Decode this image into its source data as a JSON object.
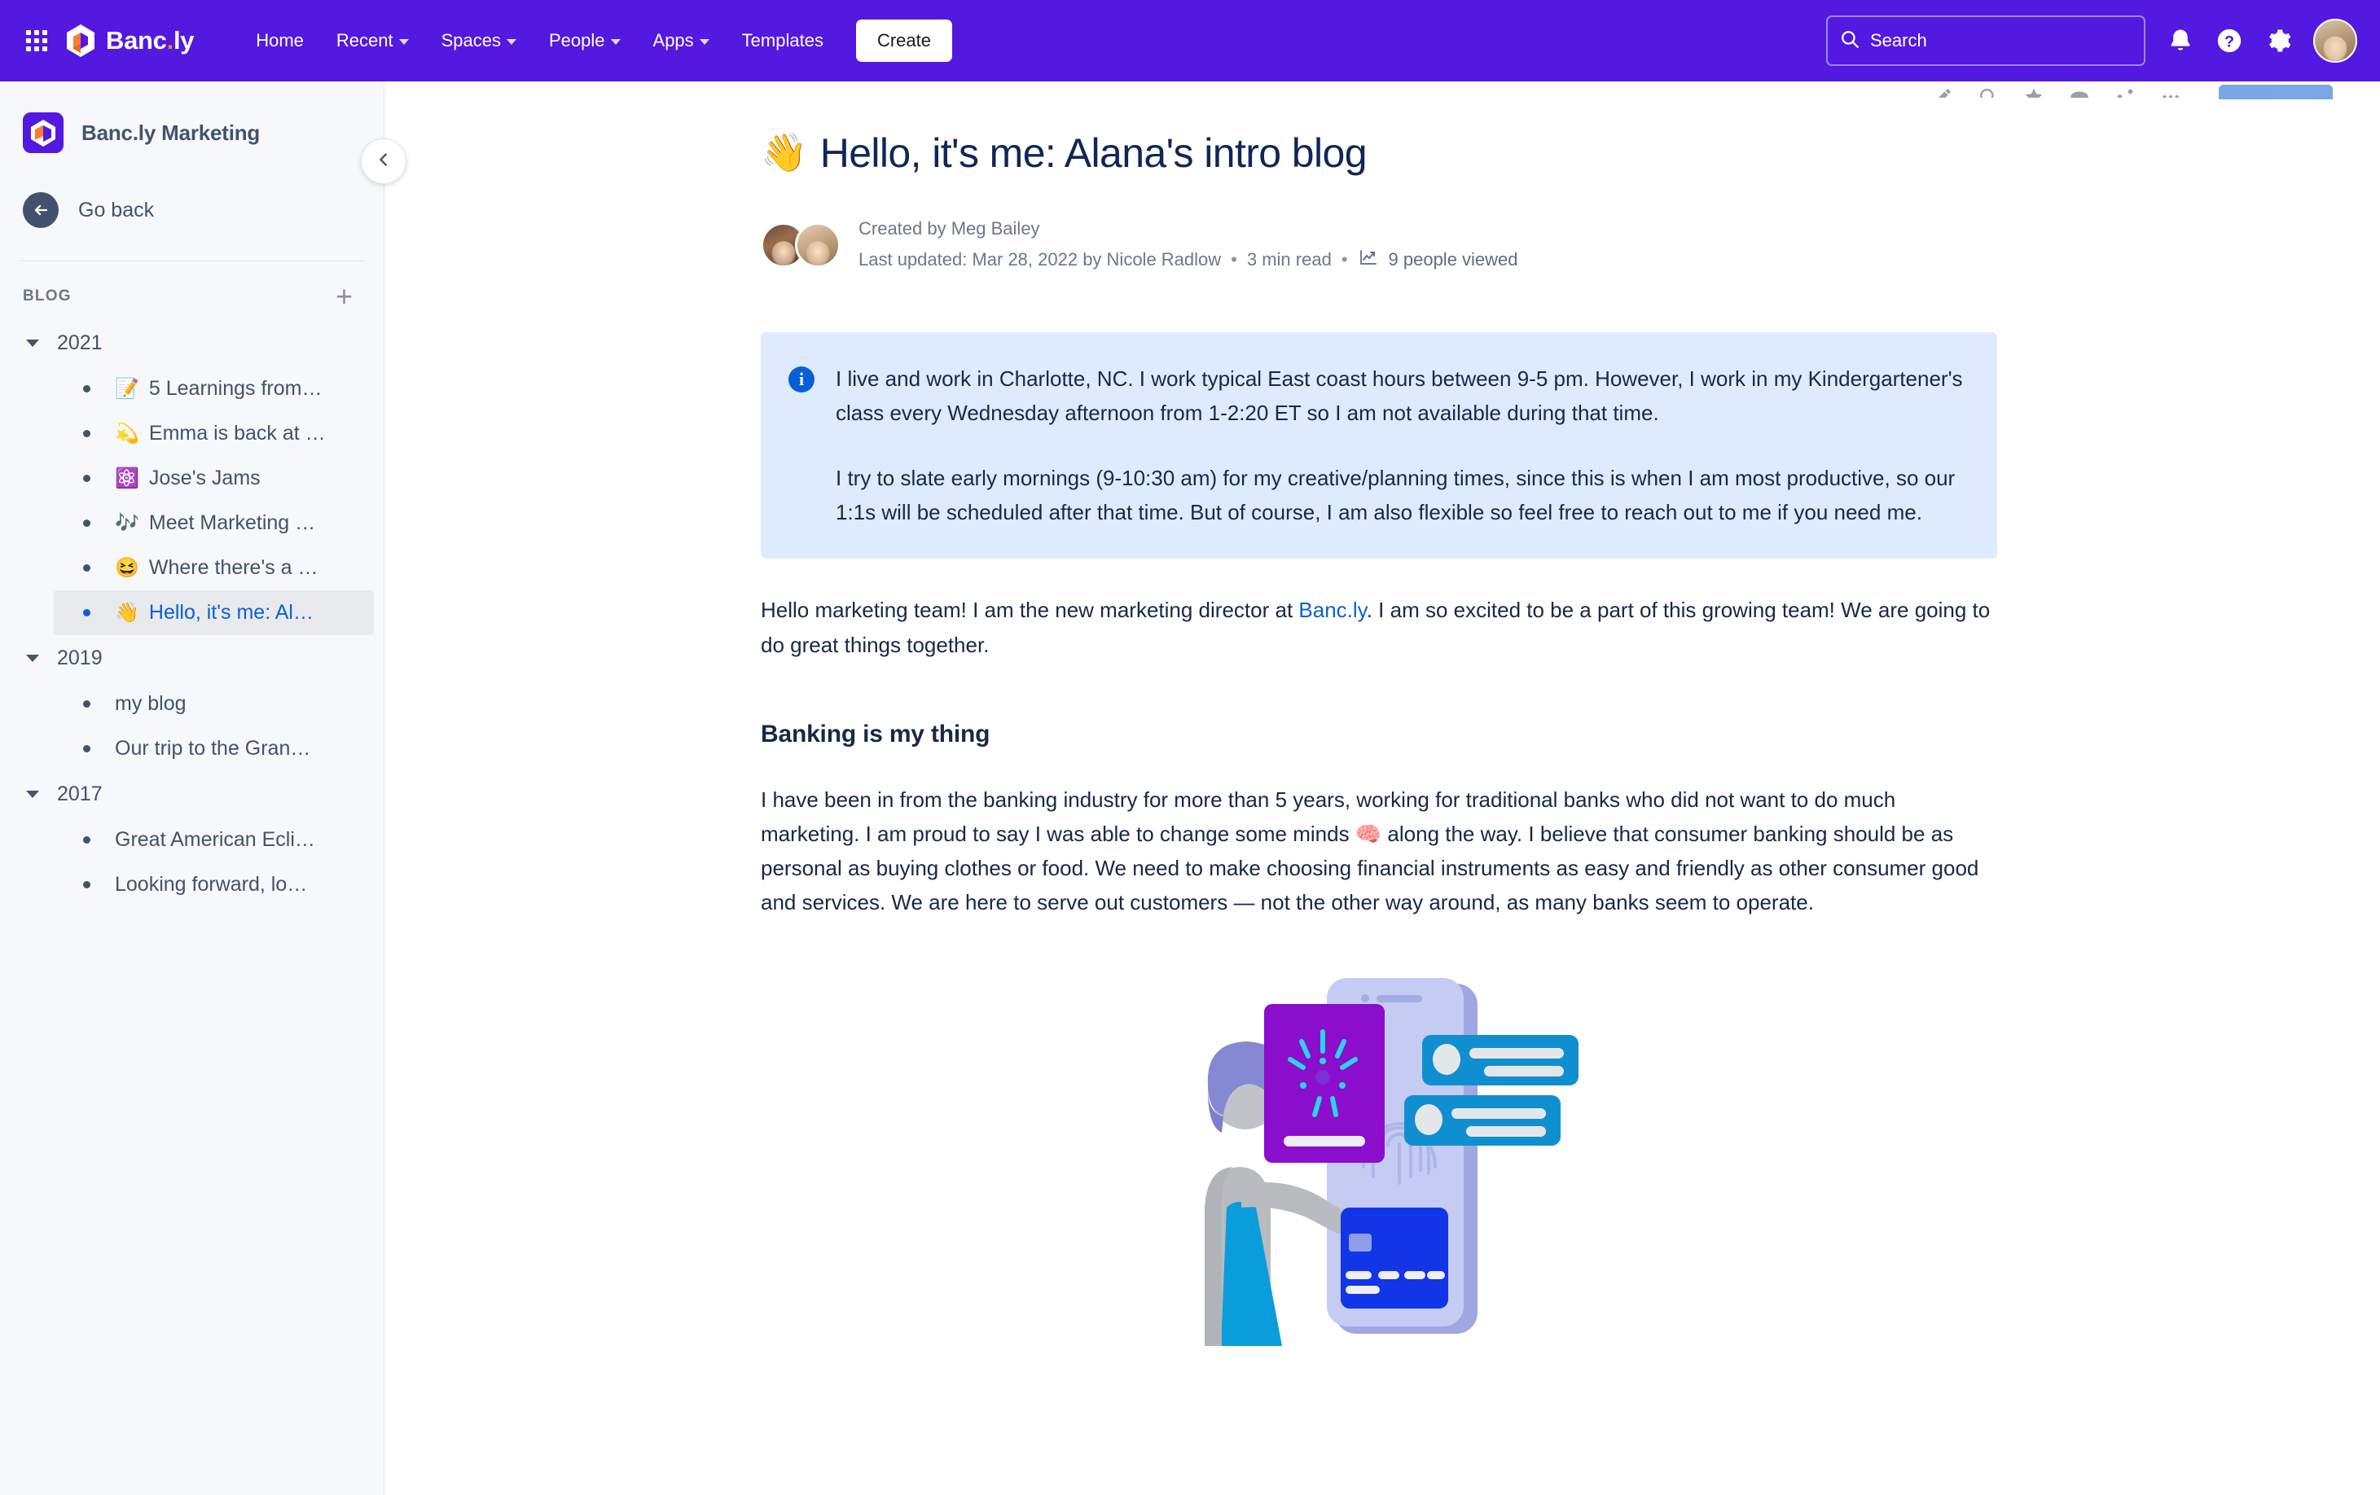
{
  "topnav": {
    "app_switcher_icon": "grid-apps-icon",
    "brand": {
      "name_main": "Banc",
      "name_dot": ".",
      "name_tld": "ly",
      "logo_icon": "bancly-hexagon-logo"
    },
    "links": [
      {
        "label": "Home",
        "has_caret": false
      },
      {
        "label": "Recent",
        "has_caret": true
      },
      {
        "label": "Spaces",
        "has_caret": true
      },
      {
        "label": "People",
        "has_caret": true
      },
      {
        "label": "Apps",
        "has_caret": true
      },
      {
        "label": "Templates",
        "has_caret": false
      }
    ],
    "create_label": "Create",
    "search": {
      "placeholder": "Search",
      "icon": "search-icon"
    },
    "icons": [
      {
        "name": "notification-bell-icon"
      },
      {
        "name": "help-question-icon"
      },
      {
        "name": "settings-gear-icon"
      }
    ],
    "avatar": "user-avatar",
    "bg_color": "#5319E0"
  },
  "sidebar": {
    "space_title": "Banc.ly Marketing",
    "go_back_label": "Go back",
    "section_label": "BLOG",
    "add_label": "+",
    "collapse_icon": "chevron-left-icon",
    "tree": [
      {
        "year": "2021",
        "expanded": true,
        "items": [
          {
            "emoji": "📝",
            "label": "5 Learnings from…",
            "selected": false
          },
          {
            "emoji": "💫",
            "label": "Emma is back at …",
            "selected": false
          },
          {
            "emoji": "⚛️",
            "label": "Jose's Jams",
            "selected": false
          },
          {
            "emoji": "🎶",
            "label": "Meet Marketing …",
            "selected": false
          },
          {
            "emoji": "😆",
            "label": "Where there's a …",
            "selected": false
          },
          {
            "emoji": "👋",
            "label": "Hello, it's me: Al…",
            "selected": true
          }
        ]
      },
      {
        "year": "2019",
        "expanded": true,
        "items": [
          {
            "emoji": "",
            "label": "my blog",
            "selected": false
          },
          {
            "emoji": "",
            "label": "Our trip to the Gran…",
            "selected": false
          }
        ]
      },
      {
        "year": "2017",
        "expanded": true,
        "items": [
          {
            "emoji": "",
            "label": "Great American Ecli…",
            "selected": false
          },
          {
            "emoji": "",
            "label": "Looking forward, lo…",
            "selected": false
          }
        ]
      }
    ]
  },
  "article": {
    "title_emoji": "👋",
    "title": "Hello, it's me: Alana's intro blog",
    "created_by": "Created by Meg Bailey",
    "last_updated": "Last updated: Mar 28, 2022 by Nicole Radlow",
    "read_time": "3 min read",
    "views": "9 people viewed",
    "views_icon": "analytics-chart-icon",
    "separator": "•",
    "info_panel": {
      "icon": "info-circle-icon",
      "paragraph_1": "I live and work in Charlotte, NC. I work typical East coast hours between 9-5 pm. However, I work in my Kindergartener's class every Wednesday afternoon from 1-2:20 ET so I am not available during that time.",
      "paragraph_2": "I try to slate early mornings (9-10:30 am) for my creative/planning times, since this is when I am most productive, so our 1:1s will be scheduled after that time. But of course, I am also flexible so feel free to reach out to me if you need me.",
      "bg_color": "#DEEBFF"
    },
    "intro_before_link": "Hello marketing team! I am the new marketing director at ",
    "intro_link": "Banc.ly",
    "intro_after_link": ". I am so excited to be a part of this growing team! We are going to do great things together.",
    "heading_2": "Banking is my thing",
    "body_part_1": "I have been in from the banking industry for more than 5 years, working for traditional banks who did not want to do much marketing. I am proud to say I was able to change some minds ",
    "body_emoji": "🧠",
    "body_part_2": " along the way. I believe that consumer banking should be as personal as buying clothes or food. We need to make choosing financial instruments as easy and friendly as other consumer good and services. We are here to serve out customers — not the other way around, as many banks seem to operate.",
    "illustration": "woman-mobile-banking-illustration"
  },
  "colors": {
    "nav_purple": "#5319E0",
    "link_blue": "#0B5FD6",
    "text_navy": "#17284A",
    "muted": "#6B778C",
    "sidebar_bg": "#F7F8F9",
    "info_bg": "#DEEBFF"
  }
}
